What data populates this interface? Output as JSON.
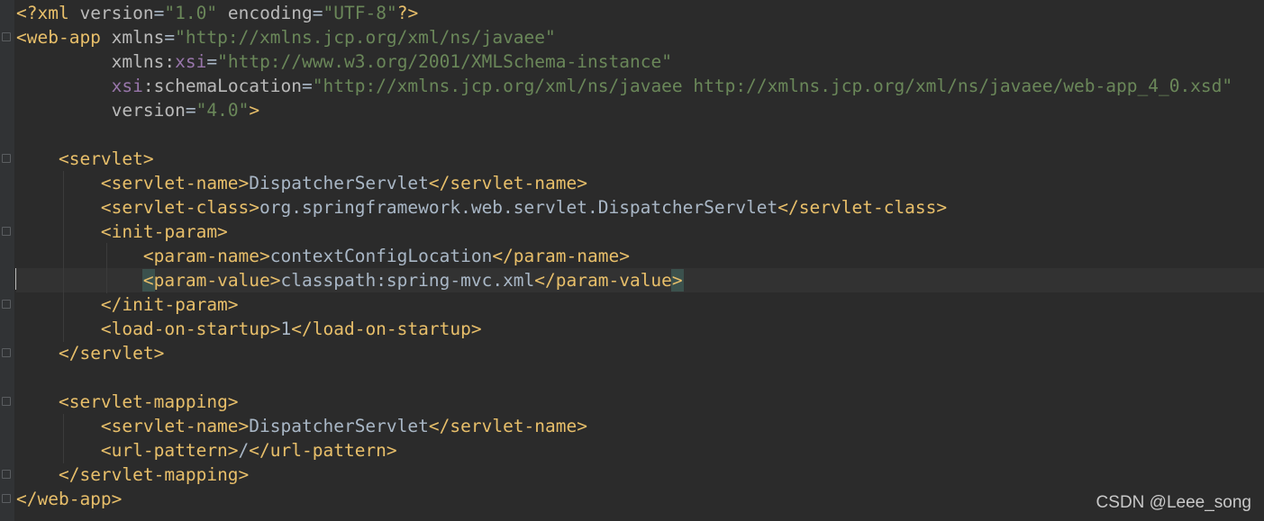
{
  "file": {
    "lines": [
      [
        {
          "c": "tag",
          "t": "<?xml "
        },
        {
          "c": "attr",
          "t": "version"
        },
        {
          "c": "txt",
          "t": "="
        },
        {
          "c": "str",
          "t": "\"1.0\""
        },
        {
          "c": "txt",
          "t": " "
        },
        {
          "c": "attr",
          "t": "encoding"
        },
        {
          "c": "txt",
          "t": "="
        },
        {
          "c": "str",
          "t": "\"UTF-8\""
        },
        {
          "c": "tag",
          "t": "?>"
        }
      ],
      [
        {
          "c": "tag",
          "t": "<web-app "
        },
        {
          "c": "attr",
          "t": "xmlns"
        },
        {
          "c": "txt",
          "t": "="
        },
        {
          "c": "str",
          "t": "\"http://xmlns.jcp.org/xml/ns/javaee\""
        }
      ],
      [
        {
          "c": "txt",
          "t": "         "
        },
        {
          "c": "attr",
          "t": "xmlns:"
        },
        {
          "c": "ns",
          "t": "xsi"
        },
        {
          "c": "txt",
          "t": "="
        },
        {
          "c": "str",
          "t": "\"http://www.w3.org/2001/XMLSchema-instance\""
        }
      ],
      [
        {
          "c": "txt",
          "t": "         "
        },
        {
          "c": "ns",
          "t": "xsi"
        },
        {
          "c": "attr",
          "t": ":schemaLocation"
        },
        {
          "c": "txt",
          "t": "="
        },
        {
          "c": "str",
          "t": "\"http://xmlns.jcp.org/xml/ns/javaee http://xmlns.jcp.org/xml/ns/javaee/web-app_4_0.xsd\""
        }
      ],
      [
        {
          "c": "txt",
          "t": "         "
        },
        {
          "c": "attr",
          "t": "version"
        },
        {
          "c": "txt",
          "t": "="
        },
        {
          "c": "str",
          "t": "\"4.0\""
        },
        {
          "c": "tag",
          "t": ">"
        }
      ],
      [],
      [
        {
          "c": "txt",
          "t": "    "
        },
        {
          "c": "tag",
          "t": "<servlet>"
        }
      ],
      [
        {
          "c": "txt",
          "t": "        "
        },
        {
          "c": "tag",
          "t": "<servlet-name>"
        },
        {
          "c": "txt",
          "t": "DispatcherServlet"
        },
        {
          "c": "tag",
          "t": "</servlet-name>"
        }
      ],
      [
        {
          "c": "txt",
          "t": "        "
        },
        {
          "c": "tag",
          "t": "<servlet-class>"
        },
        {
          "c": "txt",
          "t": "org.springframework.web.servlet.DispatcherServlet"
        },
        {
          "c": "tag",
          "t": "</servlet-class>"
        }
      ],
      [
        {
          "c": "txt",
          "t": "        "
        },
        {
          "c": "tag",
          "t": "<init-param>"
        }
      ],
      [
        {
          "c": "txt",
          "t": "            "
        },
        {
          "c": "tag",
          "t": "<param-name>"
        },
        {
          "c": "txt",
          "t": "contextConfigLocation"
        },
        {
          "c": "tag",
          "t": "</param-name>"
        }
      ],
      [
        {
          "c": "txt",
          "t": "            "
        },
        {
          "c": "tag hl",
          "t": "<"
        },
        {
          "c": "tag",
          "t": "param-value>"
        },
        {
          "c": "txt",
          "t": "classpath:spring-mvc.xml"
        },
        {
          "c": "tag",
          "t": "</param-value"
        },
        {
          "c": "tag hl",
          "t": ">"
        }
      ],
      [
        {
          "c": "txt",
          "t": "        "
        },
        {
          "c": "tag",
          "t": "</init-param>"
        }
      ],
      [
        {
          "c": "txt",
          "t": "        "
        },
        {
          "c": "tag",
          "t": "<load-on-startup>"
        },
        {
          "c": "txt",
          "t": "1"
        },
        {
          "c": "tag",
          "t": "</load-on-startup>"
        }
      ],
      [
        {
          "c": "txt",
          "t": "    "
        },
        {
          "c": "tag",
          "t": "</servlet>"
        }
      ],
      [],
      [
        {
          "c": "txt",
          "t": "    "
        },
        {
          "c": "tag",
          "t": "<servlet-mapping>"
        }
      ],
      [
        {
          "c": "txt",
          "t": "        "
        },
        {
          "c": "tag",
          "t": "<servlet-name>"
        },
        {
          "c": "txt",
          "t": "DispatcherServlet"
        },
        {
          "c": "tag",
          "t": "</servlet-name>"
        }
      ],
      [
        {
          "c": "txt",
          "t": "        "
        },
        {
          "c": "tag",
          "t": "<url-pattern>"
        },
        {
          "c": "txt",
          "t": "/"
        },
        {
          "c": "tag",
          "t": "</url-pattern>"
        }
      ],
      [
        {
          "c": "txt",
          "t": "    "
        },
        {
          "c": "tag",
          "t": "</servlet-mapping>"
        }
      ],
      [
        {
          "c": "tag",
          "t": "</web-app>"
        }
      ]
    ],
    "current_line": 11,
    "fold_lines": [
      1,
      6,
      9,
      12,
      14,
      16,
      19,
      20
    ]
  },
  "icons": {
    "intention": "lightbulb-icon"
  },
  "watermark": "CSDN @Leee_song",
  "colors": {
    "background": "#2b2b2b",
    "tag": "#e8bf6a",
    "attribute": "#bababa",
    "namespace": "#9876aa",
    "string": "#6a8759",
    "text": "#a9b7c6"
  }
}
